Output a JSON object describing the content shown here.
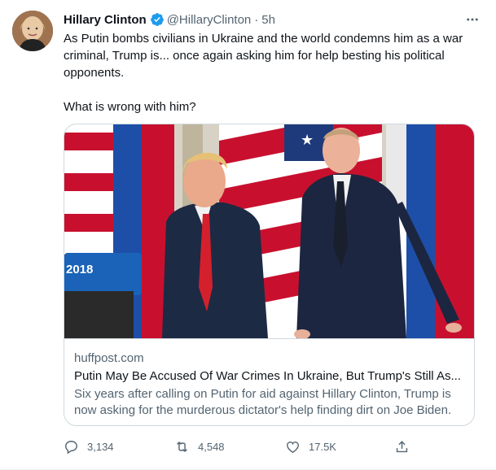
{
  "author": {
    "display_name": "Hillary Clinton",
    "handle": "@HillaryClinton",
    "separator": "·",
    "time": "5h"
  },
  "tweet": {
    "text": "As Putin bombs civilians in Ukraine and the world condemns him as a war criminal, Trump is... once again asking him for help besting his political opponents.\n\nWhat is wrong with him?"
  },
  "card": {
    "image_label": "2018",
    "domain": "huffpost.com",
    "title": "Putin May Be Accused Of War Crimes In Ukraine, But Trump's Still As...",
    "description": "Six years after calling on Putin for aid against Hillary Clinton, Trump is now asking for the murderous dictator's help finding dirt on Joe Biden."
  },
  "actions": {
    "replies": "3,134",
    "retweets": "4,548",
    "likes": "17.5K"
  },
  "colors": {
    "verified_blue": "#1d9bf0",
    "secondary_text": "#536471",
    "border": "#cfd9de"
  },
  "icons": [
    "verified-badge-icon",
    "more-icon",
    "reply-icon",
    "retweet-icon",
    "like-icon",
    "share-icon"
  ]
}
